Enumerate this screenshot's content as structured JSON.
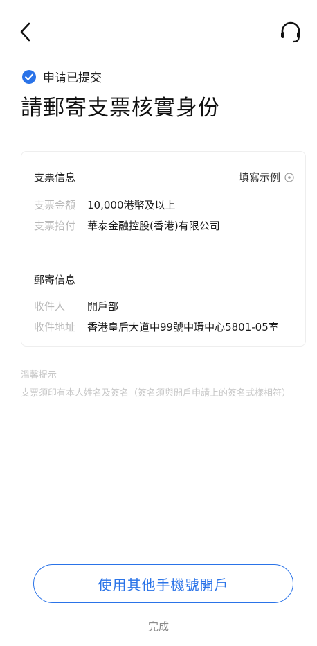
{
  "header": {
    "back_icon": "chevron-left-icon",
    "support_icon": "headset-icon"
  },
  "status": {
    "icon": "check-circle-icon",
    "text": "申请已提交",
    "color": "#2a73e8"
  },
  "title": "請郵寄支票核實身份",
  "cheque": {
    "section_title": "支票信息",
    "example_link": "填寫示例",
    "example_icon": "info-circle-icon",
    "amount_label": "支票金額",
    "amount_value": "10,000港幣及以上",
    "payee_label": "支票抬付",
    "payee_value": "華泰金融控股(香港)有限公司"
  },
  "mail": {
    "section_title": "郵寄信息",
    "recipient_label": "收件人",
    "recipient_value": "開戶部",
    "address_label": "收件地址",
    "address_value": "香港皇后大道中99號中環中心5801-05室"
  },
  "tips": {
    "title": "溫馨提示",
    "body": "支票須印有本人姓名及簽名（簽名須與開戶申請上的簽名式樣相符）"
  },
  "actions": {
    "other_phone_label": "使用其他手機號開戶",
    "done_label": "完成",
    "accent": "#2a73e8"
  }
}
